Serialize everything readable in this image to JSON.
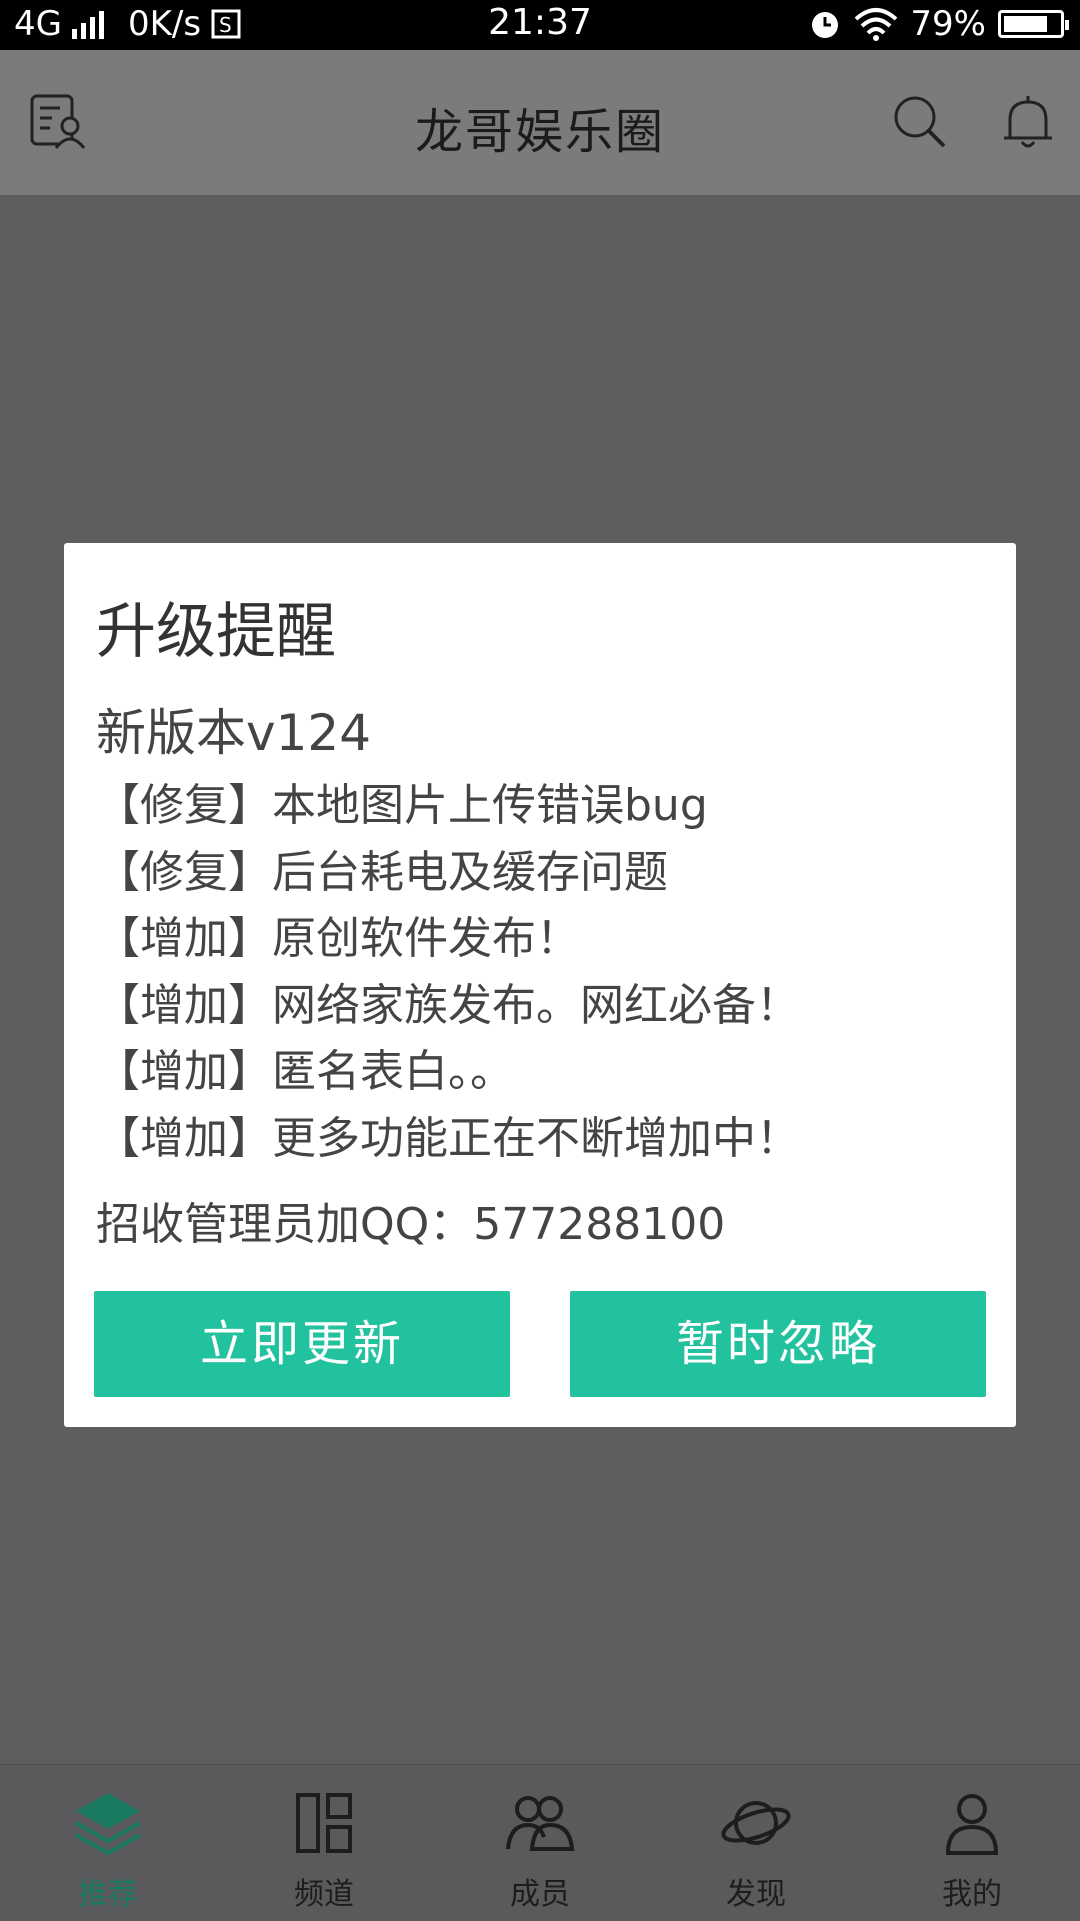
{
  "status_bar": {
    "network": "4G",
    "speed": "0K/s",
    "time": "21:37",
    "battery": "79%",
    "battery_level": 0.79
  },
  "header": {
    "title": "龙哥娱乐圈",
    "left_icon": "contacts-icon",
    "right_icons": [
      "search-icon",
      "bell-icon"
    ]
  },
  "dialog": {
    "title": "升级提醒",
    "version": "新版本v124",
    "items": [
      "【修复】本地图片上传错误bug",
      "【修复】后台耗电及缓存问题",
      "【增加】原创软件发布！",
      "【增加】网络家族发布。网红必备！",
      "【增加】匿名表白。。",
      "【增加】更多功能正在不断增加中！"
    ],
    "contact": "招收管理员加QQ：577288100",
    "update_button": "立即更新",
    "ignore_button": "暂时忽略",
    "accent_color": "#21c29d"
  },
  "bottom_nav": {
    "tabs": [
      {
        "label": "推荐",
        "icon": "layers-icon",
        "active": true
      },
      {
        "label": "频道",
        "icon": "grid-icon",
        "active": false
      },
      {
        "label": "成员",
        "icon": "group-icon",
        "active": false
      },
      {
        "label": "发现",
        "icon": "planet-icon",
        "active": false
      },
      {
        "label": "我的",
        "icon": "user-icon",
        "active": false
      }
    ],
    "active_color": "#1a7a62"
  }
}
